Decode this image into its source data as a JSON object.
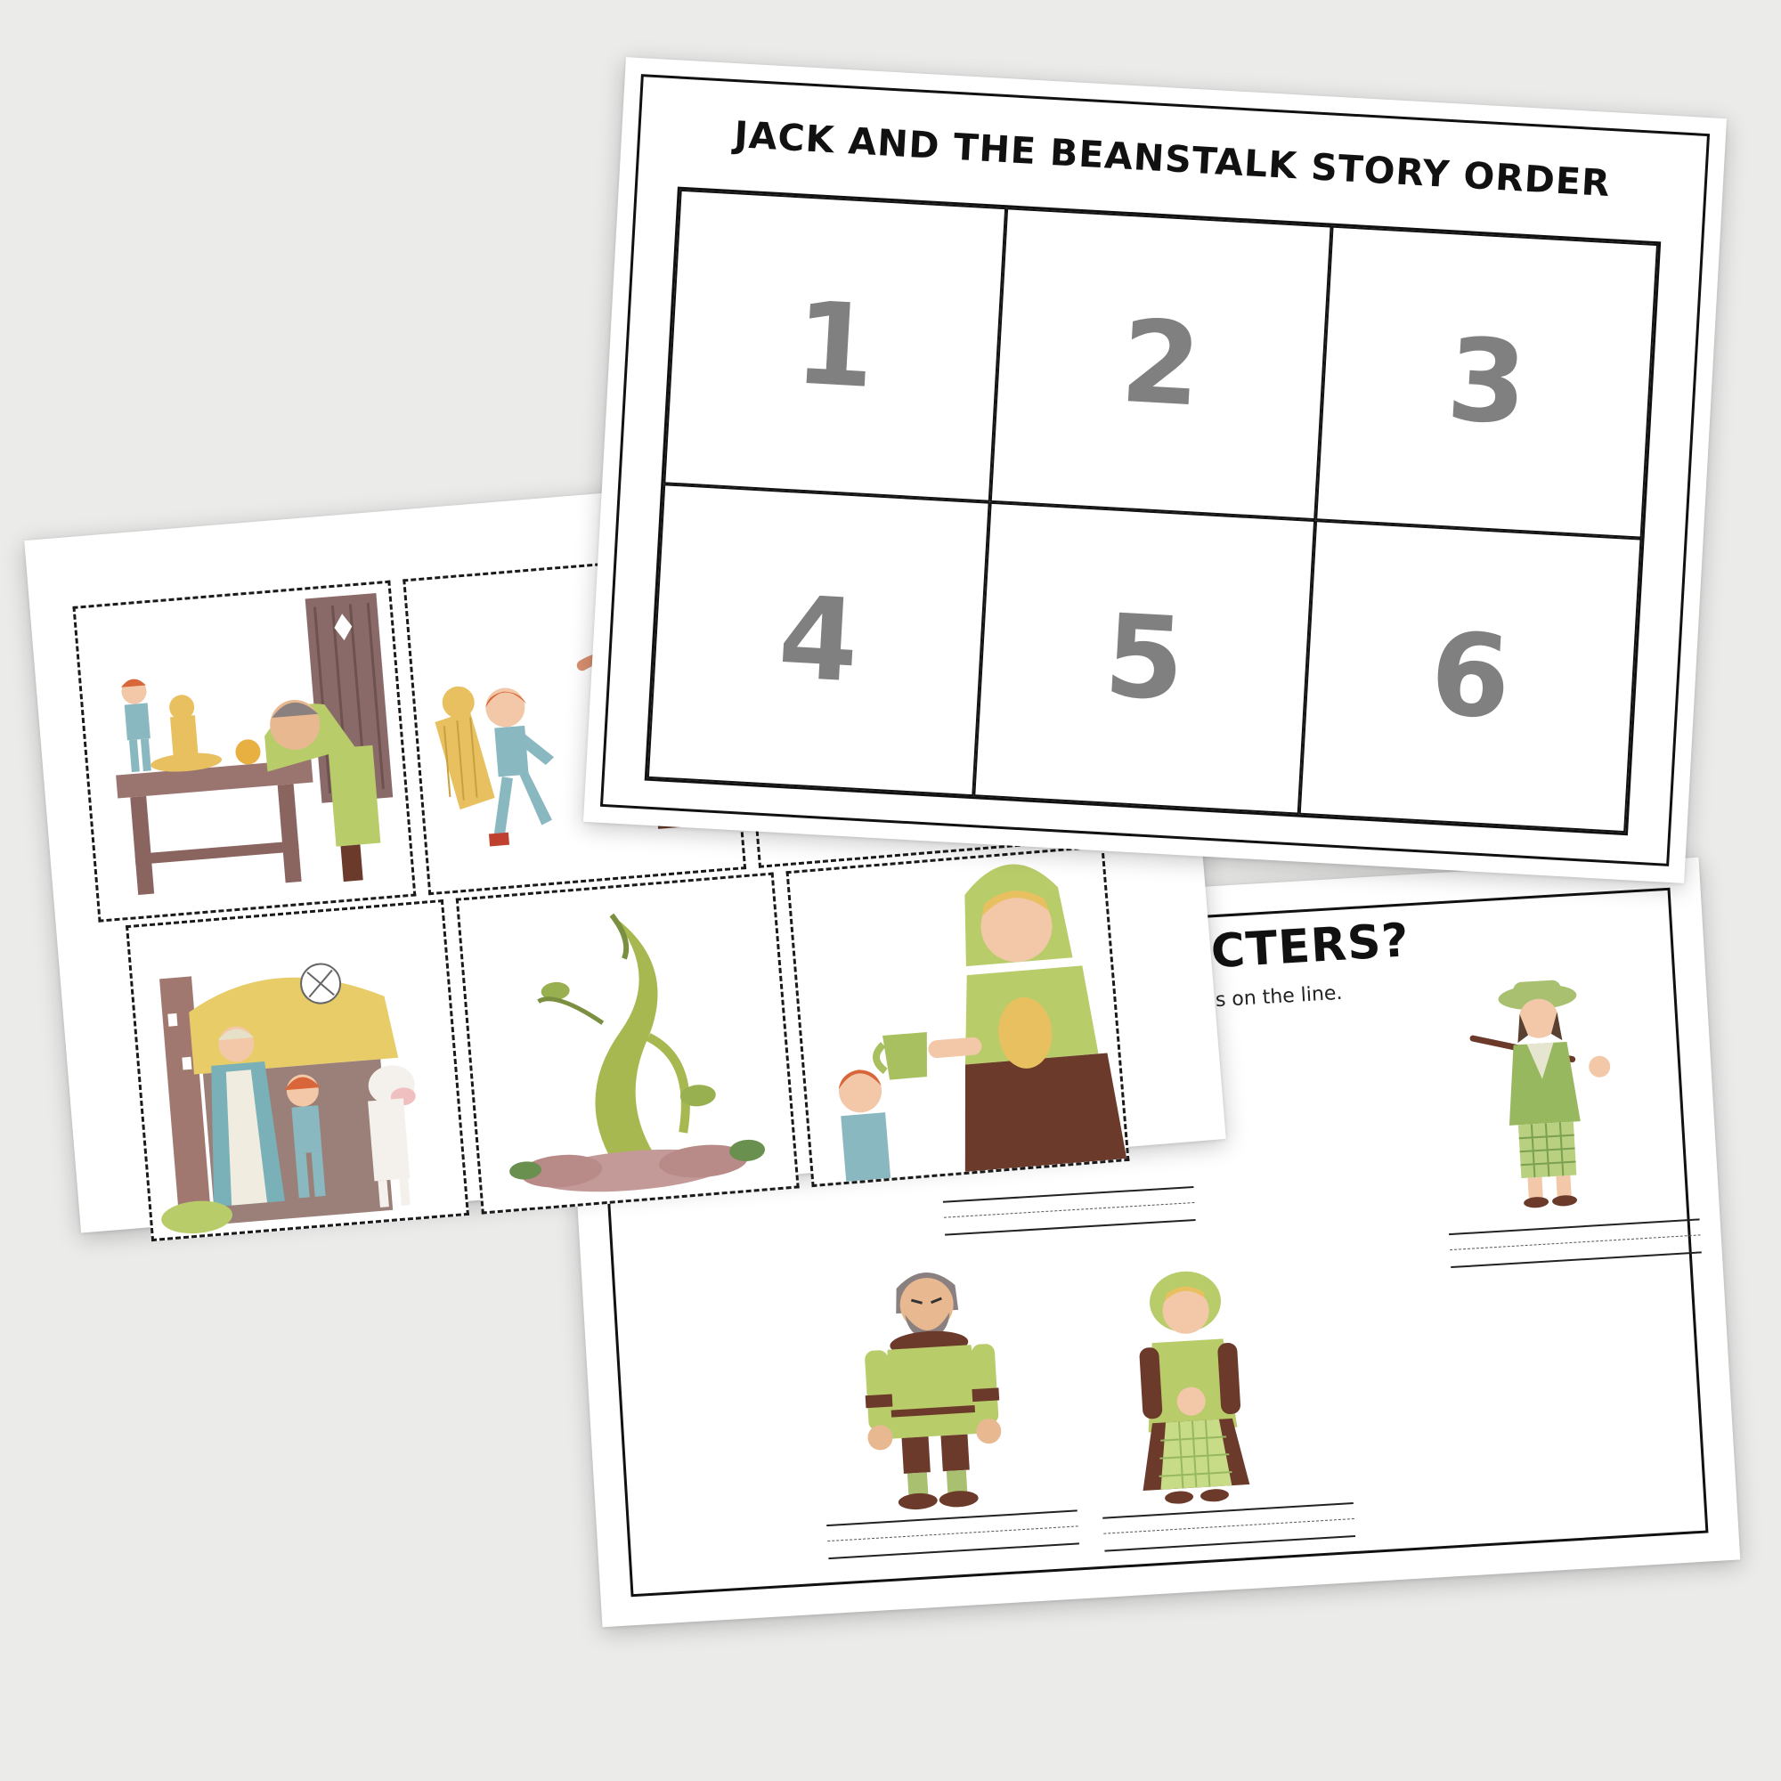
{
  "story_order_sheet": {
    "title": "JACK AND THE BEANSTALK STORY ORDER",
    "boxes": [
      "1",
      "2",
      "3",
      "4",
      "5",
      "6"
    ]
  },
  "characters_sheet": {
    "title": "CHARACTERS?",
    "instruction": "who the character is on the line."
  },
  "picture_cards": [
    {
      "scene": "jack-taking-golden-harp-from-sleeping-giant"
    },
    {
      "scene": "jack-running-with-harp"
    },
    {
      "scene": "hidden-card"
    },
    {
      "scene": "jack-with-mother-and-cow-at-cottage"
    },
    {
      "scene": "magic-beanstalk"
    },
    {
      "scene": "giants-wife-giving-jack-a-drink"
    }
  ],
  "colors": {
    "background": "#ebebea",
    "number_gray": "#808080",
    "leaf_green": "#a8b850",
    "brown": "#6b3a2a",
    "jack_hair": "#d8663a",
    "blue_shirt": "#8ab8c0"
  }
}
